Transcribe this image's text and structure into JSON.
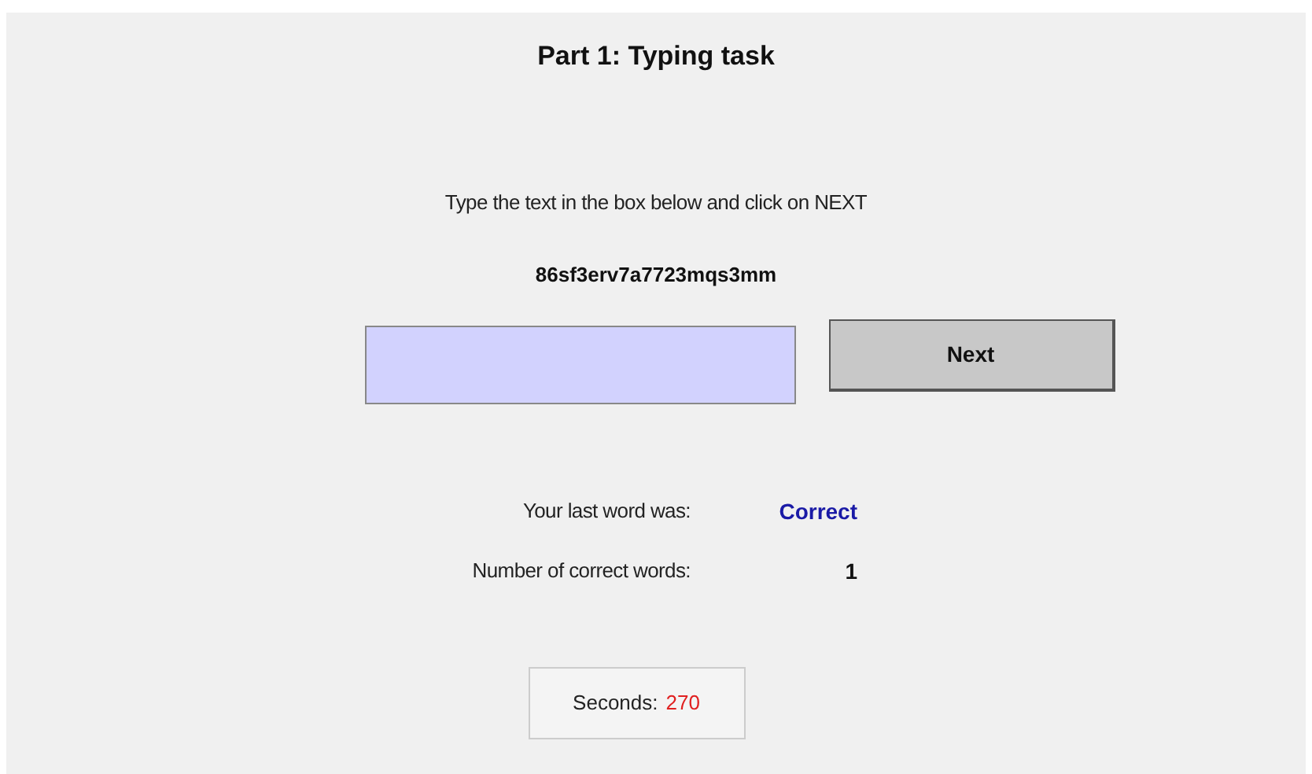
{
  "title": "Part 1: Typing task",
  "instruction": "Type the text in the box below and click on NEXT",
  "target_text": "86sf3erv7a7723mqs3mm",
  "next_button": "Next",
  "stats": [
    {
      "label": "Your last word was:",
      "value": "Correct",
      "color": "#1a1aa6"
    },
    {
      "label": "Number of correct words:",
      "value": "1",
      "color": "#111111"
    }
  ],
  "timer": {
    "label": "Seconds:",
    "value": "270"
  }
}
